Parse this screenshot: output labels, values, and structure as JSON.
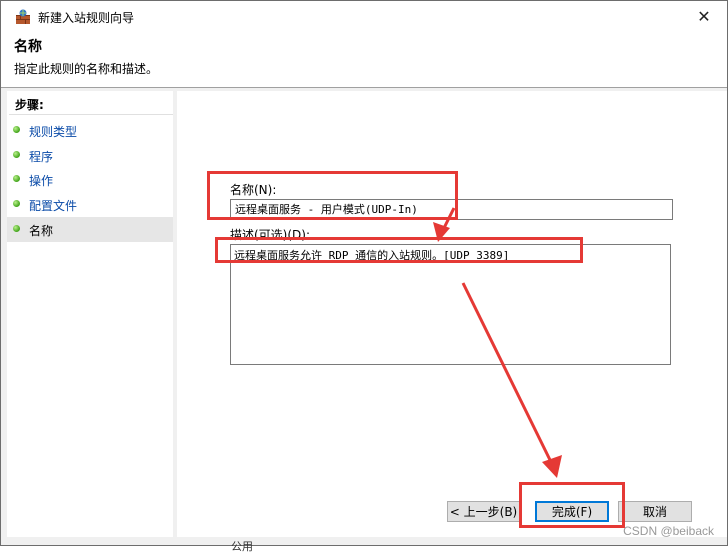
{
  "window": {
    "title": "新建入站规则向导",
    "close_glyph": "✕"
  },
  "header": {
    "title": "名称",
    "description": "指定此规则的名称和描述。"
  },
  "steps": {
    "title": "步骤:",
    "items": [
      {
        "label": "规则类型"
      },
      {
        "label": "程序"
      },
      {
        "label": "操作"
      },
      {
        "label": "配置文件"
      },
      {
        "label": "名称"
      }
    ]
  },
  "form": {
    "name_label": "名称(N):",
    "name_value": "远程桌面服务 - 用户模式(UDP-In)",
    "desc_label": "描述(可选)(D):",
    "desc_value": "远程桌面服务允许 RDP 通信的入站规则。[UDP 3389]"
  },
  "buttons": {
    "back": "< 上一步(B)",
    "finish": "完成(F)",
    "cancel": "取消"
  },
  "background_fragment": "公用",
  "watermark": "CSDN @beiback",
  "colors": {
    "annotation_red": "#e53935",
    "link_blue": "#0a4ba8",
    "focus_blue": "#0078d7",
    "step_dot_green": "#41a31a"
  }
}
